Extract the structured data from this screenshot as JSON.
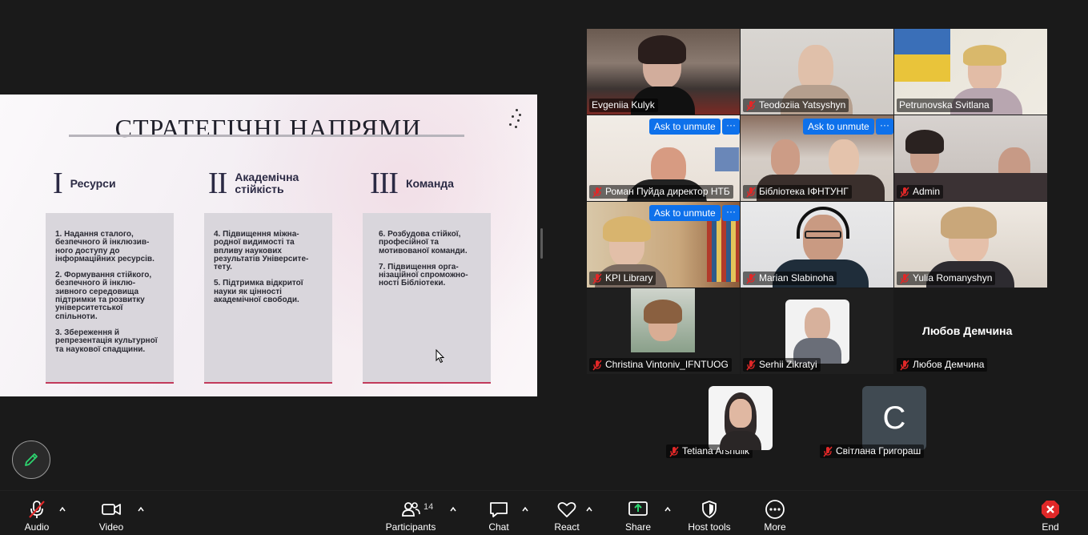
{
  "slide": {
    "title": "СТРАТЕГІЧНІ НАПРЯМИ",
    "columns": [
      {
        "numeral": "I",
        "label": "Ресурси",
        "items": [
          "1. Надання сталого, безпечного й інклюзив-ного доступу до інформаційних ресурсів.",
          "2. Формування стійкого, безпечного й інклю-зивного середовища підтримки та розвитку університетської спільноти.",
          "3. Збереження й репрезентація культурної та наукової спадщини."
        ]
      },
      {
        "numeral": "II",
        "label": "Академічна стійкість",
        "items": [
          "4. Підвищення міжна-родної видимості та впливу наукових результатів Університе-тету.",
          "5. Підтримка відкритої науки як цінності академічної свободи."
        ]
      },
      {
        "numeral": "III",
        "label": "Команда",
        "items": [
          "6. Розбудова стійкої, професійної та мотивованої команди.",
          "7. Підвищення орга-нізаційної спроможно-ності Бібліотеки."
        ]
      }
    ]
  },
  "gallery": {
    "ask_to_unmute": "Ask to unmute",
    "more": "···",
    "participants": [
      {
        "name": "Evgeniia Kulyk",
        "muted": false,
        "active": true
      },
      {
        "name": "Teodoziia Yatsyshyn",
        "muted": true
      },
      {
        "name": "Petrunovska Svitlana",
        "muted": false
      },
      {
        "name": "Роман Пуйда директор НТБ",
        "muted": true
      },
      {
        "name": "Бібліотека ІФНТУНГ",
        "muted": true
      },
      {
        "name": "Admin",
        "muted": true
      },
      {
        "name": "KPI Library",
        "muted": true
      },
      {
        "name": "Marian Slabinoha",
        "muted": true
      },
      {
        "name": "Yulia Romanyshyn",
        "muted": true
      },
      {
        "name": "Christina Vintoniv_IFNTUOG",
        "muted": true
      },
      {
        "name": "Serhii Zikratyi",
        "muted": true
      },
      {
        "name": "Любов Демчина",
        "muted": true,
        "display_name": "Любов Демчина"
      },
      {
        "name": "Tetiana Arshulik",
        "muted": true
      },
      {
        "name": "Світлана Григораш",
        "muted": true,
        "initial": "С"
      }
    ]
  },
  "toolbar": {
    "audio": "Audio",
    "video": "Video",
    "participants": "Participants",
    "participants_count": "14",
    "chat": "Chat",
    "react": "React",
    "share": "Share",
    "host_tools": "Host tools",
    "more": "More",
    "end": "End"
  },
  "colors": {
    "active_speaker": "#2dd36f",
    "ask_button": "#0e71eb",
    "muted_icon": "#e02828",
    "share_icon": "#2dd36f",
    "end_icon": "#e02828",
    "accent_line": "#c23a5b"
  }
}
